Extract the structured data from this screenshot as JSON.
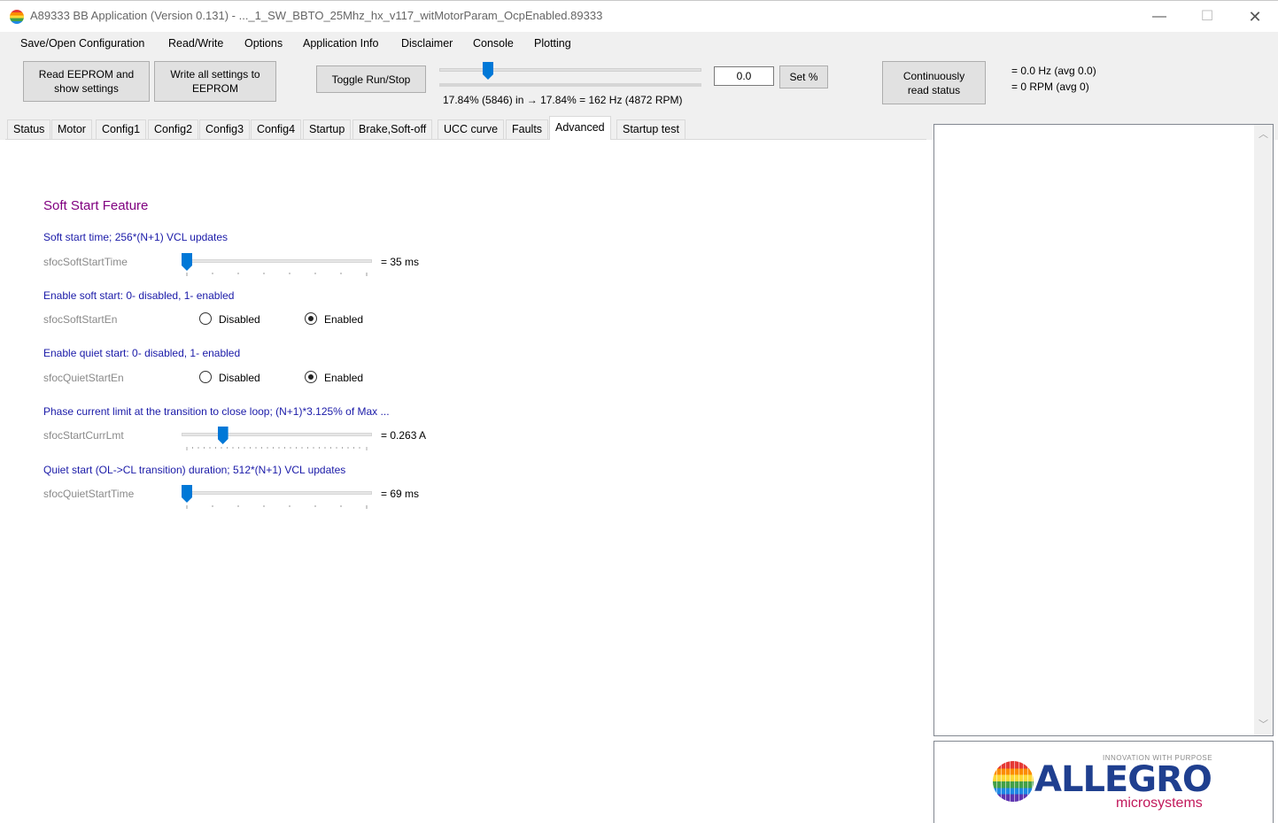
{
  "window": {
    "title": "A89333 BB Application (Version 0.131)  -  ..._1_SW_BBTO_25Mhz_hx_v117_witMotorParam_OcpEnabled.89333",
    "minimize": "—",
    "maximize": "☐",
    "close": "✕"
  },
  "menu": [
    "Save/Open Configuration",
    "Read/Write",
    "Options",
    "Application Info",
    "Disclaimer",
    "Console",
    "Plotting"
  ],
  "toolbar": {
    "read_eeprom_line1": "Read EEPROM and",
    "read_eeprom_line2": "show settings",
    "write_eeprom_line1": "Write all settings to",
    "write_eeprom_line2": "EEPROM",
    "toggle_run_stop": "Toggle Run/Stop",
    "speed_input_value": "0.0",
    "set_percent": "Set %",
    "speed_readout": "17.84% (5846) in → 17.84% = 162 Hz (4872 RPM)",
    "speed_slider_fraction": 0.18,
    "continuous_line1": "Continuously",
    "continuous_line2": "read status",
    "status_hz": "= 0.0 Hz (avg 0.0)",
    "status_rpm": "= 0 RPM (avg 0)"
  },
  "tabs": [
    "Status",
    "Motor",
    "Config1",
    "Config2",
    "Config3",
    "Config4",
    "Startup",
    "Brake,Soft-off",
    "UCC curve",
    "Faults",
    "Advanced",
    "Startup test"
  ],
  "active_tab": "Advanced",
  "content": {
    "section_title": "Soft Start Feature",
    "soft_start_time": {
      "desc": "Soft start time; 256*(N+1) VCL updates",
      "param": "sfocSoftStartTime",
      "value": "= 35 ms",
      "fraction": 0.0
    },
    "soft_start_en": {
      "desc": "Enable soft start: 0- disabled, 1- enabled",
      "param": "sfocSoftStartEn",
      "opt_disabled": "Disabled",
      "opt_enabled": "Enabled",
      "selected": "Enabled"
    },
    "quiet_start_en": {
      "desc": "Enable quiet start: 0- disabled, 1- enabled",
      "param": "sfocQuietStartEn",
      "opt_disabled": "Disabled",
      "opt_enabled": "Enabled",
      "selected": "Enabled"
    },
    "start_curr_lmt": {
      "desc": "Phase current limit at the transition to close loop; (N+1)*3.125% of Max  ...",
      "param": "sfocStartCurrLmt",
      "value": "= 0.263 A",
      "fraction": 0.2
    },
    "quiet_start_time": {
      "desc": "Quiet start (OL->CL transition) duration; 512*(N+1) VCL updates",
      "param": "sfocQuietStartTime",
      "value": "= 69 ms",
      "fraction": 0.0
    }
  },
  "right_panel": {
    "scroll_up": "︿",
    "scroll_down": "﹀"
  },
  "logo": {
    "tagline": "INNOVATION WITH PURPOSE",
    "wordmark": "ALLEGRO",
    "sub": "microsystems"
  }
}
